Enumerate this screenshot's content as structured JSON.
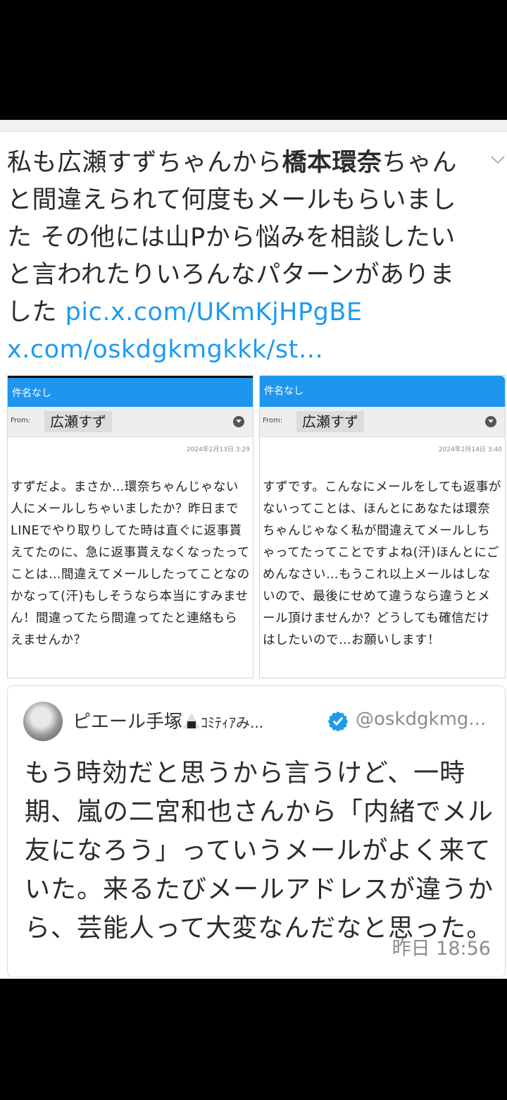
{
  "tweet": {
    "text_before": "私も広瀬すずちゃんから",
    "text_bold": "橋本環奈",
    "text_after": "ちゃんと間違えられて何度もメールもらいました その他には山Pから悩みを相談したいと言われたりいろんなパターンがありました",
    "link1": "pic.x.com/UKmKjHPgBE",
    "link2": "x.com/oskdgkmgkkk/st…"
  },
  "mail_left": {
    "subject": "件名なし",
    "from_label": "From:",
    "from_name": "広瀬すず",
    "date": "2024年2月13日 3:29",
    "body": "すずだよ。まさか…環奈ちゃんじゃない人にメールしちゃいましたか？昨日までLINEでやり取りしてた時は直ぐに返事貰えてたのに、急に返事貰えなくなったってことは…間違えてメールしたってことなのかなって(汗)もしそうなら本当にすみません！間違ってたら間違ってたと連絡もらえませんか？"
  },
  "mail_right": {
    "subject": "件名なし",
    "from_label": "From:",
    "from_name": "広瀬すず",
    "date": "2024年2月14日 3:40",
    "body": "すずです。こんなにメールをしても返事がないってことは、ほんとにあなたは環奈ちゃんじゃなく私が間違えてメールしちゃってたってことですよね(汗)ほんとにごめんなさい…もうこれ以上メールはしないので、最後にせめて違うなら違うとメール頂けませんか？どうしても確信だけはしたいので…お願いします！"
  },
  "quote": {
    "name": "ピエール手塚",
    "name_suffix": "ｺﾐﾃｨｱみ...",
    "handle": "@oskdgkmg...",
    "text": "もう時効だと思うから言うけど、一時期、嵐の二宮和也さんから「内緒でメル友になろう」っていうメールがよく来ていた。来るたびメールアドレスが違うから、芸能人って大変なんだなと思った。",
    "time": "昨日 18:56",
    "icons": [
      "avatar",
      "onigiri-emoji",
      "verified-icon"
    ]
  },
  "colors": {
    "link": "#1d9bf0",
    "mail_header": "#1e96f0",
    "verified": "#1d9bf0"
  }
}
